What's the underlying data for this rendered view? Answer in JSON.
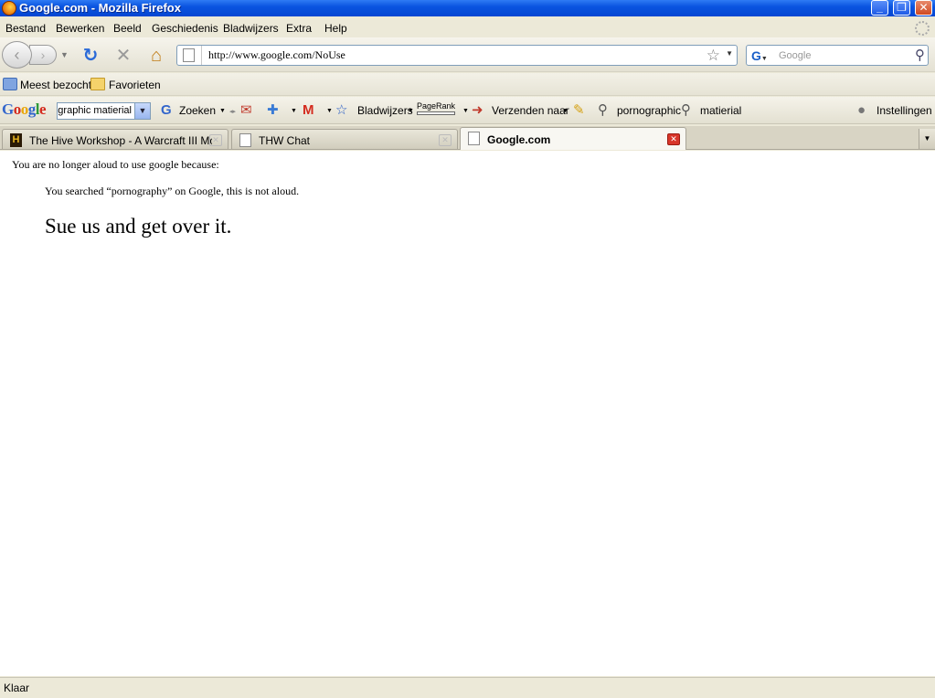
{
  "window": {
    "title": "Google.com - Mozilla Firefox"
  },
  "menu": [
    "Bestand",
    "Bewerken",
    "Beeld",
    "Geschiedenis",
    "Bladwijzers",
    "Extra",
    "Help"
  ],
  "navbar": {
    "url": "http://www.google.com/NoUse",
    "search_placeholder": "Google"
  },
  "bookmarks": [
    "Meest bezocht",
    "Favorieten"
  ],
  "google_toolbar": {
    "logo": "Google",
    "search_value": "graphic matierial",
    "search_label": "Zoeken",
    "bookmarks_label": "Bladwijzers",
    "pagerank_label": "PageRank",
    "send_label": "Verzenden naar",
    "term1": "pornographic",
    "term2": "matierial",
    "settings_label": "Instellingen"
  },
  "tabs": [
    {
      "label": "The Hive Workshop - A Warcraft III Mo...",
      "active": false
    },
    {
      "label": "THW Chat",
      "active": false
    },
    {
      "label": "Google.com",
      "active": true
    }
  ],
  "content": {
    "line1": "You are no longer aloud to use google because:",
    "line2": "You searched “pornography” on Google, this is not aloud.",
    "line3": "Sue us and get over it."
  },
  "status": "Klaar",
  "colors": {
    "titlebar": "#0a54e0",
    "chrome": "#ece9d8",
    "google_blue": "#3366cc",
    "google_red": "#d42b1e",
    "close_red": "#d8362a"
  }
}
